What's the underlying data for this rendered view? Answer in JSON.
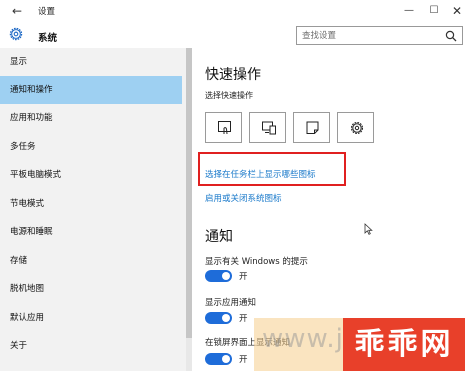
{
  "window": {
    "back_glyph": "←",
    "title": "设置",
    "minimize_glyph": "—",
    "maximize_glyph": "☐",
    "close_glyph": "✕"
  },
  "header": {
    "title": "系统",
    "icon": "gear-icon"
  },
  "search": {
    "placeholder": "查找设置",
    "value": "",
    "icon": "search-icon"
  },
  "sidebar": {
    "items": [
      {
        "label": "显示"
      },
      {
        "label": "通知和操作",
        "active": true
      },
      {
        "label": "应用和功能"
      },
      {
        "label": "多任务"
      },
      {
        "label": "平板电脑模式"
      },
      {
        "label": "节电模式"
      },
      {
        "label": "电源和睡眠"
      },
      {
        "label": "存储"
      },
      {
        "label": "脱机地图"
      },
      {
        "label": "默认应用"
      },
      {
        "label": "关于"
      }
    ]
  },
  "main": {
    "quick_actions": {
      "title": "快速操作",
      "subtitle": "选择快速操作",
      "tiles": [
        {
          "icon": "tablet-mode-icon"
        },
        {
          "icon": "connect-icon"
        },
        {
          "icon": "note-icon"
        },
        {
          "icon": "settings-icon"
        }
      ],
      "link_taskbar_icons": "选择在任务栏上显示哪些图标",
      "link_system_icons": "启用或关闭系统图标"
    },
    "notifications": {
      "title": "通知",
      "settings": [
        {
          "label": "显示有关 Windows 的提示",
          "toggle": "开",
          "on": true
        },
        {
          "label": "显示应用通知",
          "toggle": "开",
          "on": true
        },
        {
          "label": "在锁屏界面上显示通知",
          "toggle": "开",
          "on": true
        }
      ]
    }
  },
  "watermark": {
    "url_fragment": "www.jis",
    "logo_text": "乖乖网"
  },
  "colors": {
    "sidebar_bg": "#f2f2f2",
    "active_item": "#9ed0f2",
    "link": "#1979ca",
    "toggle_on": "#1e6cd9",
    "highlight_border": "#e02020",
    "logo_bg": "#e8402a"
  }
}
